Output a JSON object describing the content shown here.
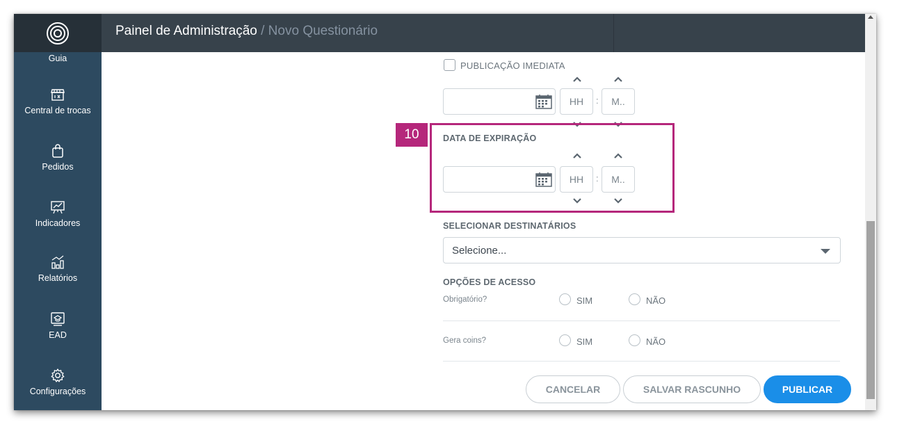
{
  "header": {
    "title": "Painel de Administração",
    "breadcrumb": " / Novo Questionário"
  },
  "sidebar": {
    "items": [
      {
        "label": "Guia",
        "icon": "guide-icon"
      },
      {
        "label": "Central de trocas",
        "icon": "store-icon"
      },
      {
        "label": "Pedidos",
        "icon": "shopping-bag-icon"
      },
      {
        "label": "Indicadores",
        "icon": "presentation-chart-icon"
      },
      {
        "label": "Relatórios",
        "icon": "bar-chart-icon"
      },
      {
        "label": "EAD",
        "icon": "monitor-graduation-icon"
      },
      {
        "label": "Configurações",
        "icon": "gear-icon"
      }
    ]
  },
  "form": {
    "immediate_publish_label": "PUBLICAÇÃO IMEDIATA",
    "publish_time": {
      "hour_placeholder": "HH",
      "minute_placeholder": "M..",
      "separator": ":"
    },
    "step_badge": "10",
    "expiration_label": "DATA DE EXPIRAÇÃO",
    "expiration_time": {
      "hour_placeholder": "HH",
      "minute_placeholder": "M..",
      "separator": ":"
    },
    "recipients_label": "SELECIONAR DESTINATÁRIOS",
    "recipients_value": "Selecione...",
    "access_options_label": "OPÇÕES DE ACESSO",
    "mandatory_question": "Obrigatório?",
    "coins_question": "Gera coins?",
    "yes_label": "SIM",
    "no_label": "NÃO"
  },
  "buttons": {
    "cancel": "CANCELAR",
    "save_draft": "SALVAR RASCUNHO",
    "publish": "PUBLICAR"
  },
  "colors": {
    "header_bg": "#37424b",
    "sidebar_bg": "#2d4a60",
    "highlight": "#b5277b",
    "primary": "#1a8ee8"
  }
}
